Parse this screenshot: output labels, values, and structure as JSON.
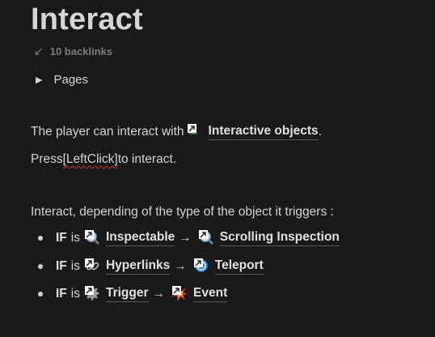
{
  "page": {
    "title": "Interact",
    "backlinks": "10 backlinks",
    "toggle_label": "Pages"
  },
  "content": {
    "line1_prefix": "The player can interact with",
    "line1_link": "Interactive objects",
    "line1_suffix": ".",
    "line2_prefix": "Press ",
    "line2_key": "[LeftClick]",
    "line2_suffix": " to interact.",
    "line3": "Interact, depending of the type of the object it triggers :"
  },
  "rules": [
    {
      "if": "IF",
      "is": "is",
      "source": "Inspectable",
      "source_icon": "magnifier-icon",
      "arrow": "→",
      "target": "Scrolling Inspection",
      "target_icon": "magnifier-icon"
    },
    {
      "if": "IF",
      "is": "is",
      "source": "Hyperlinks",
      "source_icon": "chain-link-icon",
      "arrow": "→",
      "target": "Teleport",
      "target_icon": "swirl-icon"
    },
    {
      "if": "IF",
      "is": "is",
      "source": "Trigger",
      "source_icon": "gear-icon",
      "arrow": "→",
      "target": "Event",
      "target_icon": "explosion-icon"
    }
  ],
  "colors": {
    "background": "#191919",
    "text": "#d4d4d4",
    "muted": "#7d7d7d",
    "spellcheck": "#c83a3a"
  }
}
